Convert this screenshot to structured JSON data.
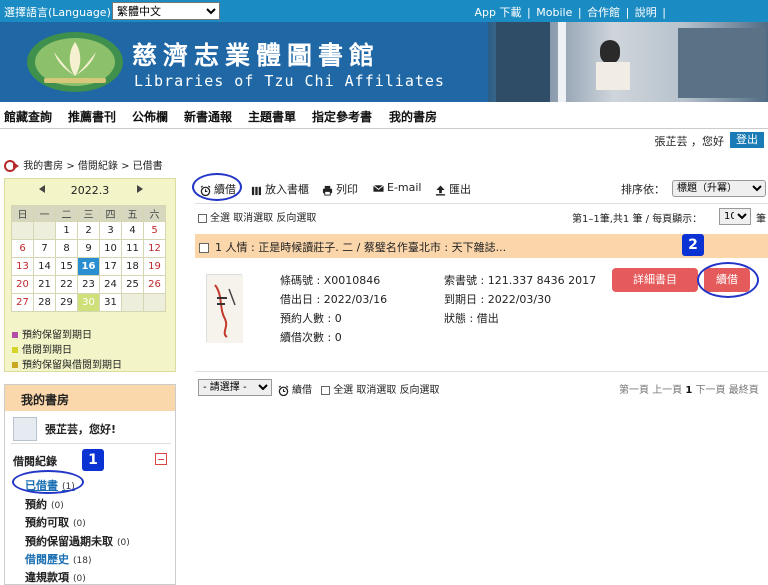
{
  "topbar": {
    "lang_label": "選擇語言(Language) :",
    "lang_value": "繁體中文",
    "links": [
      "App 下載",
      "|",
      "Mobile",
      "|",
      "合作館",
      "|",
      "說明",
      "|"
    ]
  },
  "banner": {
    "title_zh": "慈濟志業體圖書館",
    "title_en": "Libraries of Tzu Chi Affiliates"
  },
  "nav": [
    "館藏查詢",
    "推薦書刊",
    "公佈欄",
    "新書通報",
    "主題書單",
    "指定參考書",
    "我的書房"
  ],
  "user": {
    "greeting": "張芷芸 ，您好",
    "logout": "登出"
  },
  "breadcrumb": "我的書房 > 借閱紀錄 > 已借書",
  "calendar": {
    "month": "2022.3",
    "weekdays": [
      "日",
      "一",
      "二",
      "三",
      "四",
      "五",
      "六"
    ],
    "weeks": [
      [
        "",
        "",
        "1",
        "2",
        "3",
        "4",
        "5"
      ],
      [
        "6",
        "7",
        "8",
        "9",
        "10",
        "11",
        "12"
      ],
      [
        "13",
        "14",
        "15",
        "16",
        "17",
        "18",
        "19"
      ],
      [
        "20",
        "21",
        "22",
        "23",
        "24",
        "25",
        "26"
      ],
      [
        "27",
        "28",
        "29",
        "30",
        "31",
        "",
        ""
      ]
    ],
    "today": "16",
    "due_date": "30",
    "legend": [
      "預約保留到期日",
      "借閱到期日",
      "預約保留與借閱到期日"
    ],
    "colors": {
      "reserve": "#b44ca8",
      "due": "#d4d42a",
      "both": "#c8a820",
      "weekend_red": "#c0282d",
      "today_bg": "#2a8fd0",
      "due_bg": "#cfe07a"
    }
  },
  "mylib": {
    "header": "我的書房",
    "hello": "張芷芸，您好!",
    "section": "借閱紀錄",
    "items": [
      {
        "label": "已借書",
        "count": "(1)"
      },
      {
        "label": "預約",
        "count": "(0)"
      },
      {
        "label": "預約可取",
        "count": "(0)"
      },
      {
        "label": "預約保留過期未取",
        "count": "(0)"
      },
      {
        "label": "借閱歷史",
        "count": "(18)"
      },
      {
        "label": "違規款項",
        "count": "(0)"
      }
    ]
  },
  "badges": {
    "one": "1",
    "two": "2"
  },
  "toolbar": {
    "renew": "續借",
    "shelf": "放入書櫃",
    "print": "列印",
    "email": "E-mail",
    "export": "匯出",
    "sort_label": "排序依：",
    "sort_value": "標題（升冪）"
  },
  "select_links": {
    "all": "全選",
    "cancel": "取消選取",
    "invert": "反向選取"
  },
  "paging": {
    "summary": "第1–1筆,共1 筆 /",
    "per_page_label": "每頁顯示：",
    "per_page": "10",
    "unit": "筆"
  },
  "result": {
    "title": "1 人情 : 正是時候讀莊子. 二 / 蔡璧名作臺北市 : 天下雜誌...",
    "barcode": "條碼號 : X0010846",
    "call_number": "索書號 : 121.337 8436 2017",
    "borrow_date": "借出日 : 2022/03/16",
    "due_date": "到期日 : 2022/03/30",
    "reservations": "預約人數 : 0",
    "status": "狀態 : 借出",
    "renew_count": "續借次數 : 0",
    "detail_btn": "詳細書目",
    "renew_btn": "續借"
  },
  "bottom": {
    "select": "- 請選擇 -",
    "renew": "續借",
    "pager_first": "第一頁",
    "pager_prev": "上一頁",
    "pager_current": "1",
    "pager_next": "下一頁",
    "pager_last": "最終頁"
  }
}
